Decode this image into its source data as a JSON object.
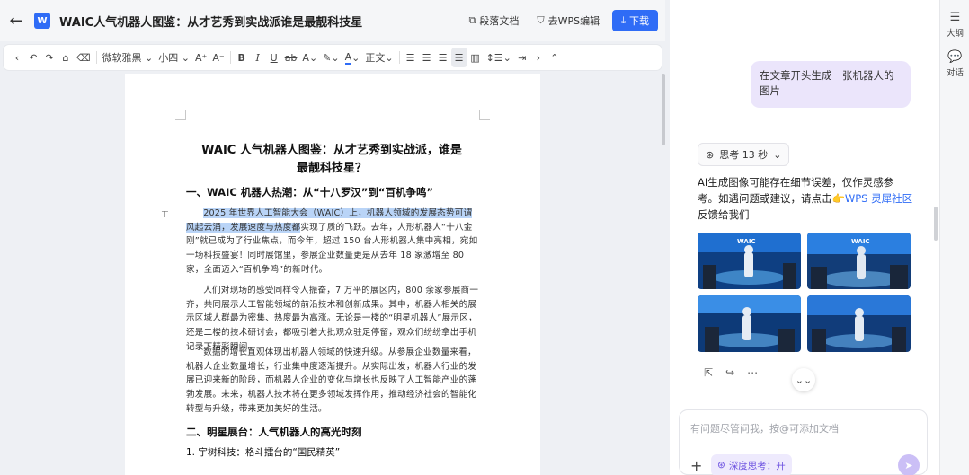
{
  "titlebar": {
    "back_icon": "←",
    "doc_icon_text": "W",
    "title": "WAIC人气机器人图鉴：从才艺秀到实战派谁是最靓科技星",
    "btn_more_docs": "段落文档",
    "btn_wps": "去WPS编辑",
    "btn_download": "下载"
  },
  "toolbar": {
    "font_family": "微软雅黑",
    "font_size": "小四",
    "spacing": "正文"
  },
  "document": {
    "h1": "WAIC 人气机器人图鉴：从才艺秀到实战派，谁是最靓科技星？",
    "section1": "一、WAIC 机器人热潮：从“十八罗汉”到“百机争鸣”",
    "p1_highlight": "2025 年世界人工智能大会（WAIC）上，机器人领域的发展态势可谓风起云涌，发展速度与热度都",
    "p1_rest": "实现了质的飞跃。去年，人形机器人“十八金刚”就已成为了行业焦点，而今年，超过 150 台人形机器人集中亮相，宛如一场科技盛宴！同时展馆里，参展企业数量更是从去年 18 家激增至 80 家，全面迈入“百机争鸣”的新时代。",
    "p2": "人们对现场的感受同样令人振奋，7 万平的展区内，800 余家参展商一齐，共同展示人工智能领域的前沿技术和创新成果。其中，机器人相关的展示区域人群最为密集、热度最为高涨。无论是一楼的“明星机器人”展示区，还是二楼的技术研讨会，都吸引着大批观众驻足停留，观众们纷纷拿出手机记录下精彩瞬间。",
    "p3": "数据的增长直观体现出机器人领域的快速升级。从参展企业数量来看，机器人企业数量增长，行业集中度逐渐提升。从实际出发，机器人行业的发展已迎来新的阶段，而机器人企业的变化与增长也反映了人工智能产业的蓬勃发展。未来，机器人技术将在更多领域发挥作用，推动经济社会的智能化转型与升级，带来更加美好的生活。",
    "section2": "二、明星展台：人气机器人的高光时刻",
    "section2_1": "1. 宇树科技：格斗擂台的“国民精英”"
  },
  "ai": {
    "user_message": "在文章开头生成一张机器人的图片",
    "thinking_label": "思考 13 秒",
    "reply_before_link": "AI生成图像可能存在细节误差，仅作灵感参考。如遇问题或建议，请点击",
    "reply_link": "WPS 灵犀社区",
    "reply_after_link": "反馈给我们",
    "image_brand": "WAIC",
    "composer_placeholder": "有问题尽管问我，按@可添加文档",
    "deep_think_label": "深度思考：开"
  },
  "rail": {
    "outline_label": "大纲",
    "chat_label": "对话"
  },
  "colors": {
    "accent": "#2f6cf6",
    "user_bubble": "#ebe5fb",
    "highlight": "#b9d4f7"
  }
}
